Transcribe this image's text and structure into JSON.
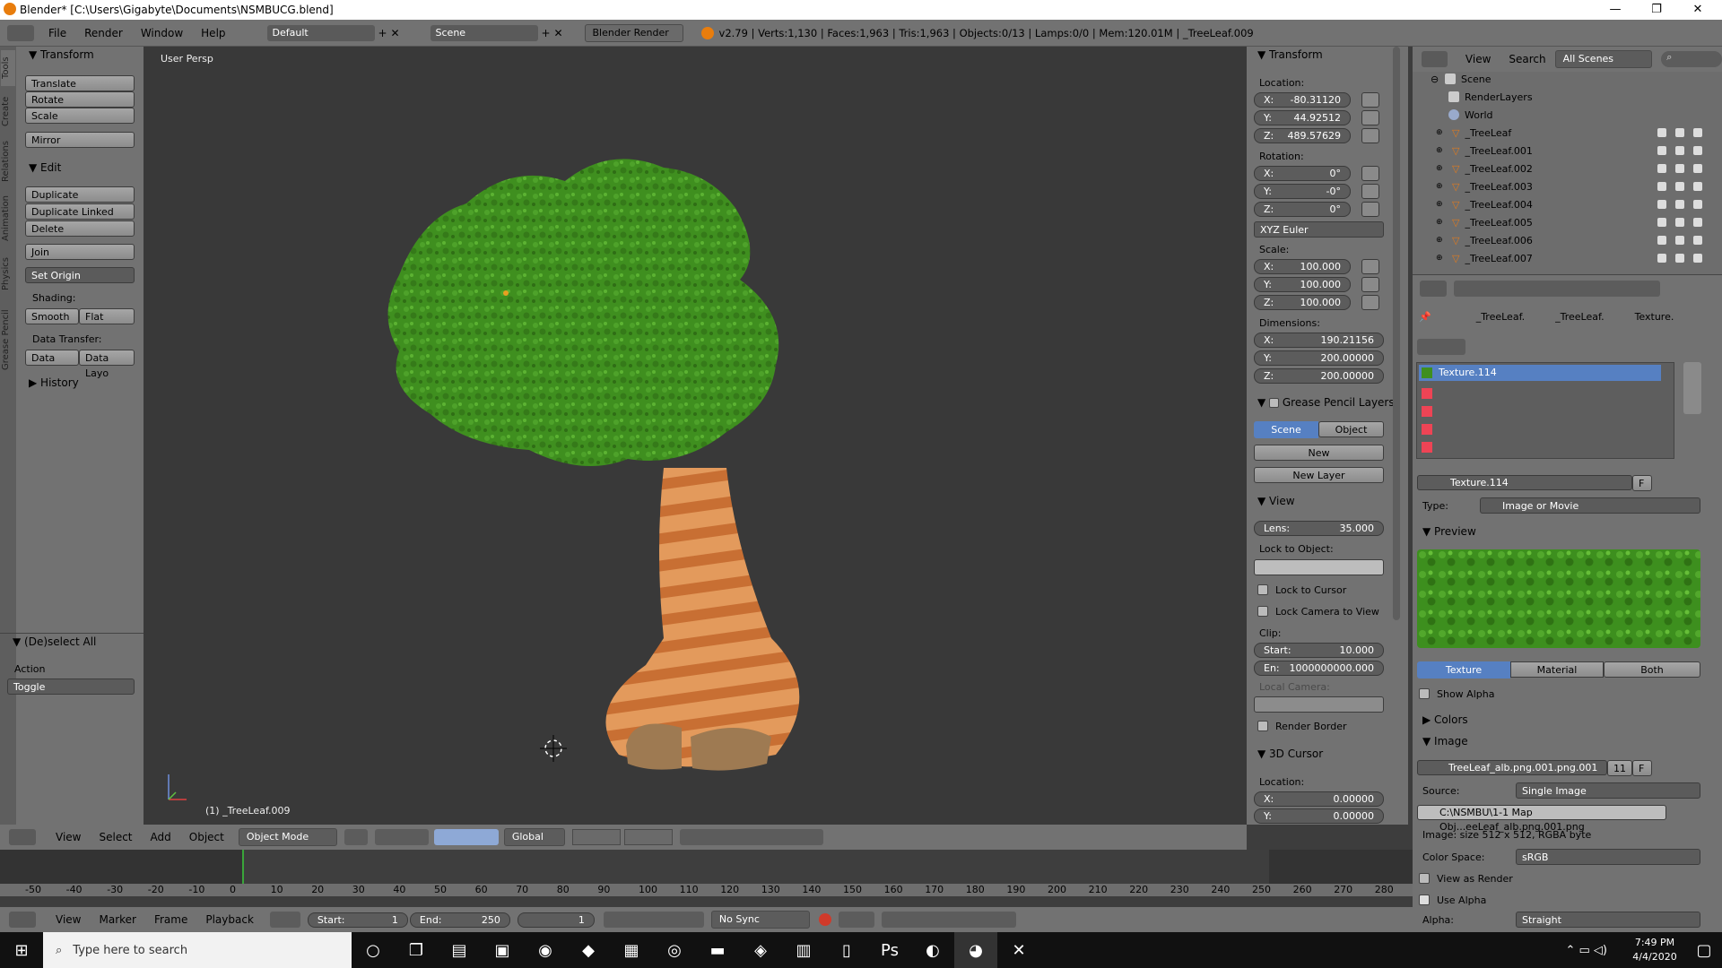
{
  "window": {
    "title": "Blender* [C:\\Users\\Gigabyte\\Documents\\NSMBUCG.blend]",
    "minimize": "—",
    "maximize": "❐",
    "close": "✕"
  },
  "topbar": {
    "menus": [
      "File",
      "Render",
      "Window",
      "Help"
    ],
    "layout": "Default",
    "scene": "Scene",
    "engine": "Blender Render",
    "stats": "v2.79 | Verts:1,130 | Faces:1,963 | Tris:1,963 | Objects:0/13 | Lamps:0/0 | Mem:120.01M | _TreeLeaf.009"
  },
  "toolshelf": {
    "tabs": [
      "Tools",
      "Create",
      "Relations",
      "Animation",
      "Physics",
      "Grease Pencil"
    ],
    "transform_header": "Transform",
    "translate": "Translate",
    "rotate": "Rotate",
    "scale": "Scale",
    "mirror": "Mirror",
    "edit_header": "Edit",
    "duplicate": "Duplicate",
    "duplicate_linked": "Duplicate Linked",
    "delete": "Delete",
    "join": "Join",
    "set_origin": "Set Origin",
    "shading_label": "Shading:",
    "smooth": "Smooth",
    "flat": "Flat",
    "data_transfer_label": "Data Transfer:",
    "data": "Data",
    "data_layout": "Data Layo",
    "history_header": "History",
    "operator_header": "(De)select All",
    "action_label": "Action",
    "action_value": "Toggle"
  },
  "viewport": {
    "view_name": "User Persp",
    "object_name": "(1) _TreeLeaf.009"
  },
  "npanel": {
    "transform_header": "Transform",
    "location_label": "Location:",
    "location": [
      {
        "k": "X:",
        "v": "-80.31120"
      },
      {
        "k": "Y:",
        "v": "44.92512"
      },
      {
        "k": "Z:",
        "v": "489.57629"
      }
    ],
    "rotation_label": "Rotation:",
    "rotation": [
      {
        "k": "X:",
        "v": "0°"
      },
      {
        "k": "Y:",
        "v": "-0°"
      },
      {
        "k": "Z:",
        "v": "0°"
      }
    ],
    "rotation_mode": "XYZ Euler",
    "scale_label": "Scale:",
    "scale": [
      {
        "k": "X:",
        "v": "100.000"
      },
      {
        "k": "Y:",
        "v": "100.000"
      },
      {
        "k": "Z:",
        "v": "100.000"
      }
    ],
    "dimensions_label": "Dimensions:",
    "dimensions": [
      {
        "k": "X:",
        "v": "190.21156"
      },
      {
        "k": "Y:",
        "v": "200.00000"
      },
      {
        "k": "Z:",
        "v": "200.00000"
      }
    ],
    "gp_header": "Grease Pencil Layers",
    "gp_scene": "Scene",
    "gp_object": "Object",
    "gp_new": "New",
    "gp_new_layer": "New Layer",
    "view_header": "View",
    "lens": {
      "k": "Lens:",
      "v": "35.000"
    },
    "lock_to_object": "Lock to Object:",
    "lock_to_cursor": "Lock to Cursor",
    "lock_camera": "Lock Camera to View",
    "clip_label": "Clip:",
    "clip_start": {
      "k": "Start:",
      "v": "10.000"
    },
    "clip_end": {
      "k": "En:",
      "v": "1000000000.000"
    },
    "local_camera": "Local Camera:",
    "render_border": "Render Border",
    "cursor_header": "3D Cursor",
    "cursor_location": "Location:",
    "cursor": [
      {
        "k": "X:",
        "v": "0.00000"
      },
      {
        "k": "Y:",
        "v": "0.00000"
      }
    ]
  },
  "outliner": {
    "view": "View",
    "search": "Search",
    "filter": "All Scenes",
    "scene": "Scene",
    "render_layers": "RenderLayers",
    "world": "World",
    "objects": [
      "_TreeLeaf",
      "_TreeLeaf.001",
      "_TreeLeaf.002",
      "_TreeLeaf.003",
      "_TreeLeaf.004",
      "_TreeLeaf.005",
      "_TreeLeaf.006",
      "_TreeLeaf.007"
    ]
  },
  "properties": {
    "breadcrumb": [
      "_TreeLeaf.",
      "_TreeLeaf.",
      "Texture."
    ],
    "slot_selected": "Texture.114",
    "texture_name": "Texture.114",
    "texture_f": "F",
    "type_label": "Type:",
    "type_value": "Image or Movie",
    "preview_header": "Preview",
    "preview_tabs": [
      "Texture",
      "Material",
      "Both"
    ],
    "show_alpha": "Show Alpha",
    "colors_header": "Colors",
    "image_header": "Image",
    "image_name": "TreeLeaf_alb.png.001.png.001",
    "image_users": "11",
    "image_f": "F",
    "source_label": "Source:",
    "source_value": "Single Image",
    "path": "C:\\NSMBU\\1-1 Map Obj...eeLeaf_alb.png.001.png",
    "image_info": "Image: size 512 x 512, RGBA byte",
    "color_space_label": "Color Space:",
    "color_space_value": "sRGB",
    "view_as_render": "View as Render",
    "use_alpha": "Use Alpha",
    "alpha_label": "Alpha:",
    "alpha_value": "Straight"
  },
  "view3d_header": {
    "menus": [
      "View",
      "Select",
      "Add",
      "Object"
    ],
    "mode": "Object Mode",
    "orientation": "Global"
  },
  "timeline": {
    "ticks": [
      "-50",
      "-40",
      "-30",
      "-20",
      "-10",
      "0",
      "10",
      "20",
      "30",
      "40",
      "50",
      "60",
      "70",
      "80",
      "90",
      "100",
      "110",
      "120",
      "130",
      "140",
      "150",
      "160",
      "170",
      "180",
      "190",
      "200",
      "210",
      "220",
      "230",
      "240",
      "250",
      "260",
      "270",
      "280"
    ],
    "menus": [
      "View",
      "Marker",
      "Frame",
      "Playback"
    ],
    "start": {
      "k": "Start:",
      "v": "1"
    },
    "end": {
      "k": "End:",
      "v": "250"
    },
    "current": "1",
    "sync": "No Sync"
  },
  "taskbar": {
    "search_placeholder": "Type here to search",
    "time": "7:49 PM",
    "date": "4/4/2020"
  },
  "colors": {
    "foliage": "#3f8f1f",
    "trunk": "#e08a4a",
    "selection": "#5680c2"
  }
}
